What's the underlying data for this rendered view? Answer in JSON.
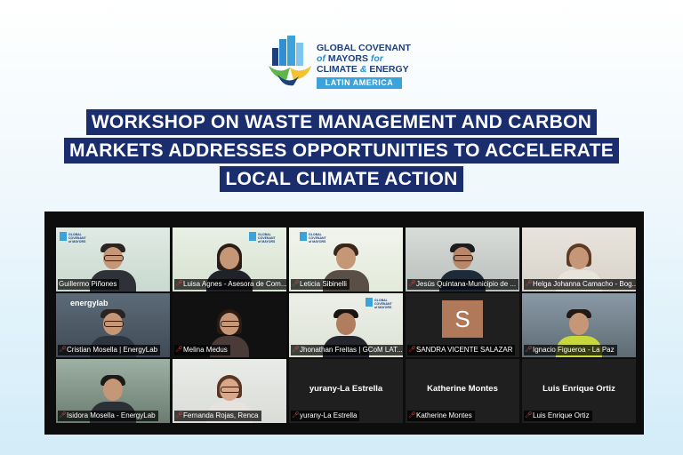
{
  "logo": {
    "line1": "GLOBAL COVENANT",
    "line2_a": "of",
    "line2_b": "MAYORS",
    "line2_c": "for",
    "line3_a": "CLIMATE",
    "line3_b": "&",
    "line3_c": "ENERGY",
    "region": "LATIN AMERICA"
  },
  "headline": {
    "line1": "WORKSHOP ON WASTE MANAGEMENT AND CARBON",
    "line2": "MARKETS ADDRESSES OPPORTUNITIES TO ACCELERATE",
    "line3": "LOCAL CLIMATE ACTION"
  },
  "tiles": {
    "t1": {
      "name": "Guillermo Piñones"
    },
    "t2": {
      "name": "Luisa Agnes - Asesora de Com..."
    },
    "t3": {
      "name": "Leticia Sibinelli"
    },
    "t4": {
      "name": "Jesús Quintana-Municipio de ..."
    },
    "t5": {
      "name": "Helga Johanna Camacho - Bog..."
    },
    "t6": {
      "name": "Cristian Mosella | EnergyLab",
      "overlay": "energylab"
    },
    "t7": {
      "name": "Melina Medus"
    },
    "t8": {
      "name": "Jhonathan Freitas | GCoM LAT..."
    },
    "t9": {
      "name": "SANDRA VICENTE SALAZAR",
      "avatar_letter": "S"
    },
    "t10": {
      "name": "Ignacio Figueroa - La Paz"
    },
    "t11": {
      "name": "Isidora Mosella - EnergyLab"
    },
    "t12": {
      "name": "Fernanda Rojas, Renca"
    },
    "t13": {
      "name": "yurany-La Estrella",
      "display": "yurany-La Estrella"
    },
    "t14": {
      "name": "Katherine Montes",
      "display": "Katherine Montes"
    },
    "t15": {
      "name": "Luis Enrique Ortiz",
      "display": "Luis Enrique Ortiz"
    }
  },
  "colors": {
    "headline_bg": "#1a2e6e",
    "brand_blue": "#3aa3db",
    "active_speaker": "#48d35a",
    "muted_mic": "#e24a4a"
  }
}
